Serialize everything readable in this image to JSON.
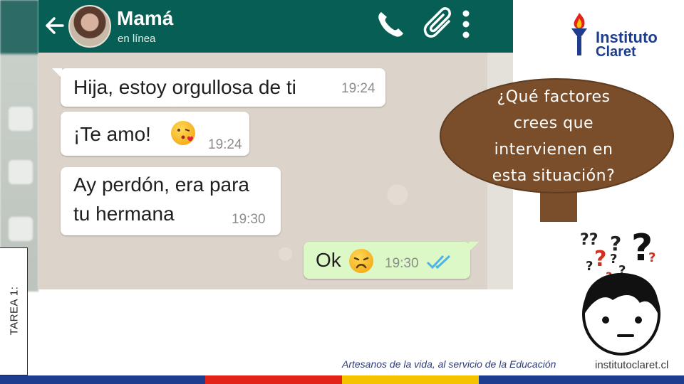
{
  "side_label": "TAREA 1:",
  "chat": {
    "contact_name": "Mamá",
    "contact_status": "en línea",
    "messages": [
      {
        "text": "Hija, estoy orgullosa de ti",
        "time": "19:24",
        "direction": "incoming"
      },
      {
        "text": "¡Te amo!",
        "emoji": "kissing-heart-emoji",
        "time": "19:24",
        "direction": "incoming"
      },
      {
        "text_line1": "Ay perdón, era para",
        "text_line2": "tu hermana",
        "time": "19:30",
        "direction": "incoming"
      },
      {
        "text": "Ok",
        "emoji": "disappointed-emoji",
        "time": "19:30",
        "direction": "outgoing",
        "status_icon": "double-check-icon"
      }
    ]
  },
  "callout": {
    "line1": "¿Qué factores",
    "line2": "crees que",
    "line3": "intervienen en",
    "line4": "esta situación?"
  },
  "logo": {
    "line1": "Instituto",
    "line2": "Claret"
  },
  "footer": {
    "slogan": "Artesanos de la vida, al servicio de la Educación",
    "url": "institutoclaret.cl"
  },
  "colors": {
    "header_green": "#075e54",
    "outgoing_bubble": "#dcf8c6",
    "callout_brown": "#7a4e2a",
    "brand_blue": "#1e3d8f",
    "stripe": [
      "#1e3d8f",
      "#e2231a",
      "#f5c400",
      "#1e3d8f"
    ]
  }
}
